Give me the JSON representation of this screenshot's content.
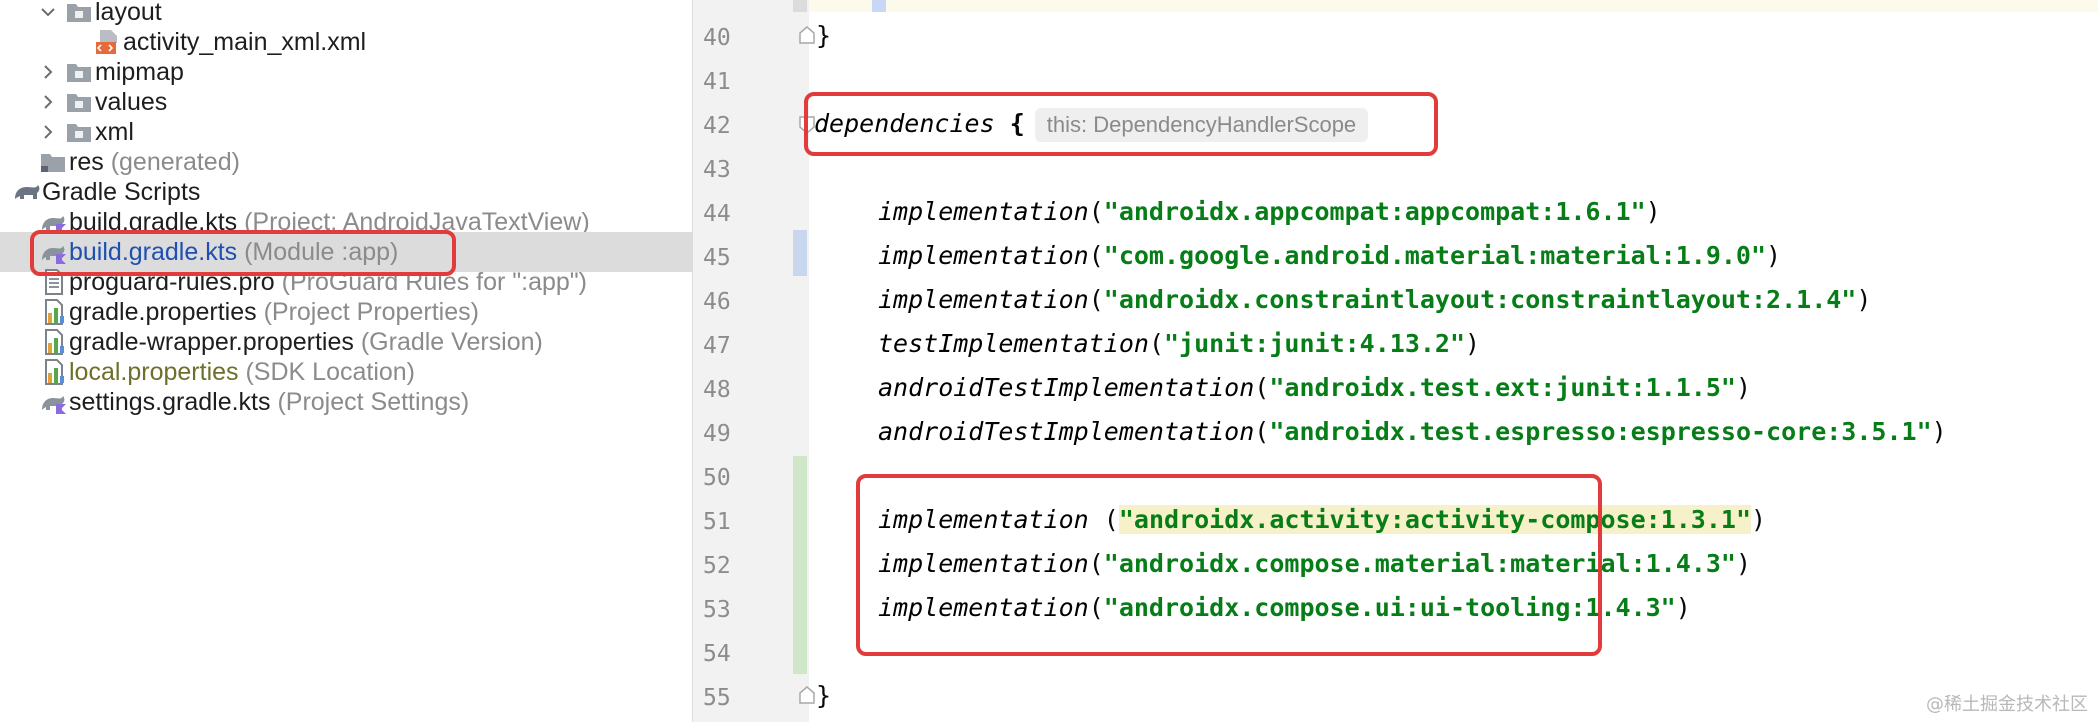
{
  "project_tree": {
    "rows": [
      {
        "name": "layout",
        "hint": ""
      },
      {
        "name": "activity_main_xml.xml",
        "hint": ""
      },
      {
        "name": "mipmap",
        "hint": ""
      },
      {
        "name": "values",
        "hint": ""
      },
      {
        "name": "xml",
        "hint": ""
      },
      {
        "name": "res",
        "hint": "(generated)"
      },
      {
        "name": "Gradle Scripts",
        "hint": ""
      },
      {
        "name": "build.gradle.kts",
        "hint": "(Project: AndroidJavaTextView)"
      },
      {
        "name": "build.gradle.kts",
        "hint": "(Module :app)"
      },
      {
        "name": "proguard-rules.pro",
        "hint": "(ProGuard Rules for \":app\")"
      },
      {
        "name": "gradle.properties",
        "hint": "(Project Properties)"
      },
      {
        "name": "gradle-wrapper.properties",
        "hint": "(Gradle Version)"
      },
      {
        "name": "local.properties",
        "hint": "(SDK Location)"
      },
      {
        "name": "settings.gradle.kts",
        "hint": "(Project Settings)"
      }
    ]
  },
  "editor": {
    "line_numbers": [
      "40",
      "41",
      "42",
      "43",
      "44",
      "45",
      "46",
      "47",
      "48",
      "49",
      "50",
      "51",
      "52",
      "53",
      "54",
      "55"
    ],
    "closing_brace": "}",
    "dependencies_keyword": "dependencies",
    "open_brace": "{",
    "type_hint": "this: DependencyHandlerScope",
    "deps": [
      {
        "fn": "implementation",
        "arg": "\"androidx.appcompat:appcompat:1.6.1\""
      },
      {
        "fn": "implementation",
        "arg": "\"com.google.android.material:material:1.9.0\""
      },
      {
        "fn": "implementation",
        "arg": "\"androidx.constraintlayout:constraintlayout:2.1.4\""
      },
      {
        "fn": "testImplementation",
        "arg": "\"junit:junit:4.13.2\""
      },
      {
        "fn": "androidTestImplementation",
        "arg": "\"androidx.test.ext:junit:1.1.5\""
      },
      {
        "fn": "androidTestImplementation",
        "arg": "\"androidx.test.espresso:espresso-core:3.5.1\""
      }
    ],
    "compose_deps": [
      {
        "fn": "implementation ",
        "arg": "\"androidx.activity:activity-compose:1.3.1\""
      },
      {
        "fn": "implementation",
        "arg": "\"androidx.compose.material:material:1.4.3\""
      },
      {
        "fn": "implementation",
        "arg": "\"androidx.compose.ui:ui-tooling:1.4.3\""
      }
    ]
  },
  "watermark": "@稀土掘金技术社区",
  "colors": {
    "string": "#067d17",
    "selection": "#dcdcdc",
    "highlight_box": "#e23b3b",
    "selected_file": "#1f4fb0"
  }
}
